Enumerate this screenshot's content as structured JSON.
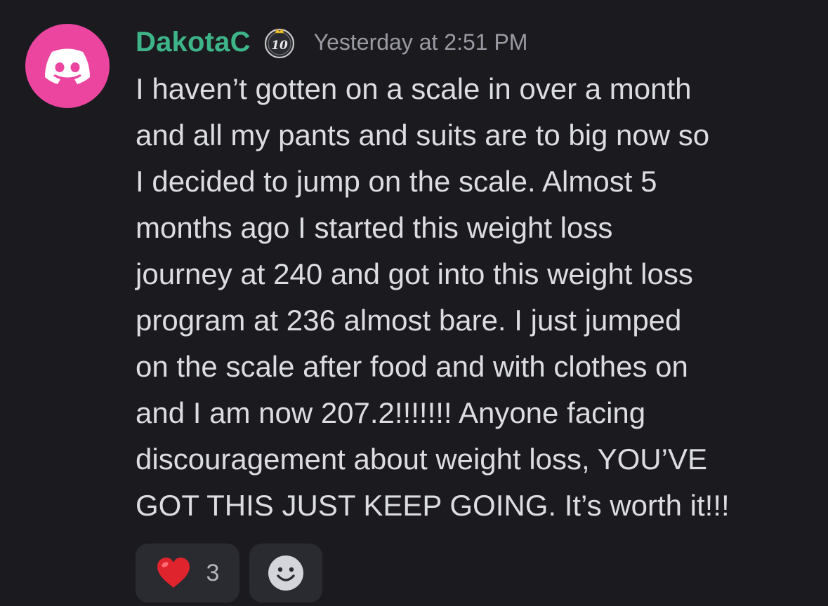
{
  "message": {
    "author": {
      "name": "DakotaC",
      "avatar_icon": "discord-logo-icon",
      "avatar_color": "#eb459f",
      "name_color": "#3eb489",
      "badge_icon": "level-crown-badge-icon",
      "badge_text": "10"
    },
    "timestamp": "Yesterday at 2:51 PM",
    "lines": [
      "I haven’t gotten on a scale in over a month",
      "and all my pants and suits are to big now so",
      "I decided to jump on the scale. Almost 5",
      "months ago I started this weight loss",
      "journey at 240 and got into this weight loss",
      "program at 236 almost bare. I just jumped",
      "on the scale after food and with clothes on",
      "and I am now 207.2!!!!!!! Anyone facing",
      "discouragement about weight loss, YOU’VE",
      "GOT THIS JUST KEEP GOING. It’s worth it!!!"
    ],
    "reactions": [
      {
        "emoji": "heart-emoji-icon",
        "count": "3"
      }
    ],
    "add_reaction_icon": "add-reaction-smiley-icon"
  }
}
